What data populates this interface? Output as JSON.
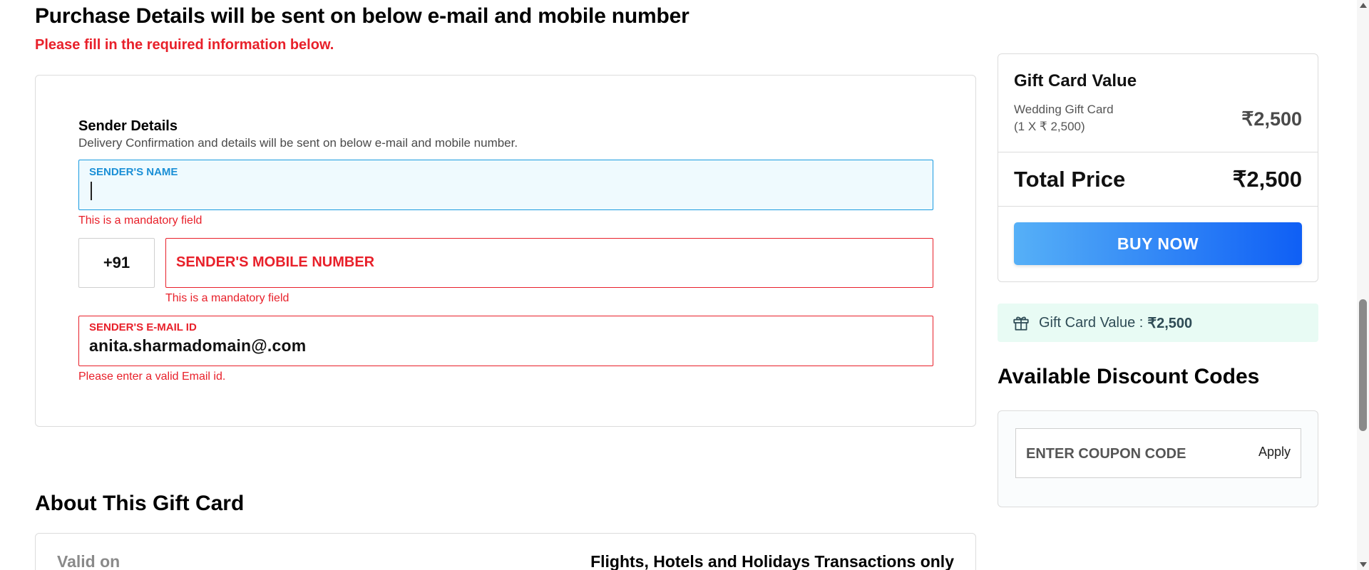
{
  "header": {
    "title": "Purchase Details will be sent on below e-mail and mobile number",
    "subtitle": "Please fill in the required information below."
  },
  "sender": {
    "heading": "Sender Details",
    "description": "Delivery Confirmation and details will be sent on below e-mail and mobile number.",
    "name_label": "SENDER'S NAME",
    "name_value": "",
    "name_error": "This is a mandatory field",
    "country_code": "+91",
    "mobile_label": "SENDER'S MOBILE NUMBER",
    "mobile_error": "This is a mandatory field",
    "email_label": "SENDER'S E-MAIL ID",
    "email_value": "anita.sharmadomain@.com",
    "email_error": "Please enter a valid Email id."
  },
  "about": {
    "title": "About This Gift Card",
    "valid_label": "Valid on",
    "valid_value": "Flights, Hotels and Holidays Transactions only"
  },
  "summary": {
    "gift_card_value_title": "Gift Card Value",
    "item_name": "Wedding Gift Card",
    "item_qty": "(1 X ₹ 2,500)",
    "item_price": "₹2,500",
    "total_label": "Total Price",
    "total_value": "₹2,500",
    "buy_label": "BUY NOW"
  },
  "banner": {
    "icon": "gift-icon",
    "label": "Gift Card Value :",
    "value": "₹2,500"
  },
  "discount": {
    "title": "Available Discount Codes",
    "coupon_placeholder": "ENTER COUPON CODE",
    "apply_label": "Apply"
  },
  "colors": {
    "error": "#e8202a",
    "active_border": "#1a9be0",
    "button_start": "#56b0f7",
    "button_end": "#0f5ff5",
    "banner_bg": "#e8fbf4"
  }
}
